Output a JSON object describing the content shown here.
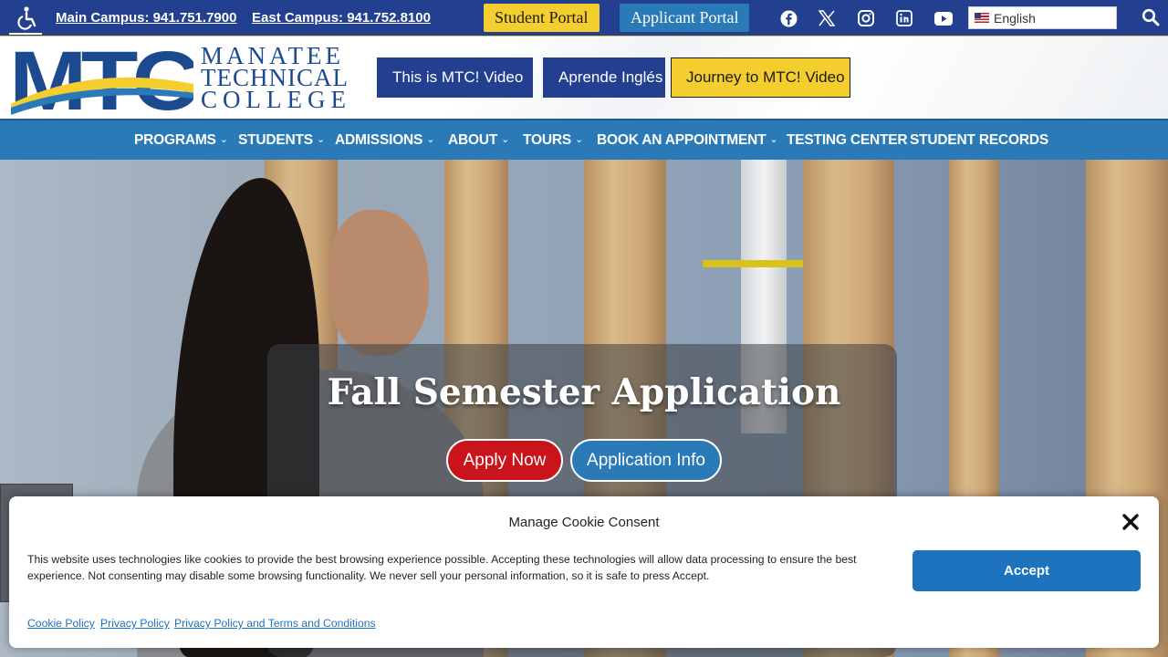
{
  "topbar": {
    "main_campus": "Main Campus: 941.751.7900",
    "east_campus": "East Campus: 941.752.8100",
    "student_portal": "Student Portal",
    "applicant_portal": "Applicant Portal",
    "social_icons": [
      "facebook-icon",
      "x-icon",
      "instagram-icon",
      "linkedin-icon",
      "youtube-icon"
    ],
    "language": "English"
  },
  "header": {
    "logo_abbrev": "MTC",
    "logo_line1": "MANATEE",
    "logo_line2": "TECHNICAL",
    "logo_line3": "COLLEGE",
    "buttons": [
      "This is MTC! Video",
      "Aprende Inglés",
      "Journey to MTC! Video"
    ]
  },
  "nav": {
    "items": [
      {
        "label": "PROGRAMS",
        "has_dropdown": true
      },
      {
        "label": "STUDENTS",
        "has_dropdown": true
      },
      {
        "label": "ADMISSIONS",
        "has_dropdown": true
      },
      {
        "label": "ABOUT",
        "has_dropdown": true
      },
      {
        "label": "TOURS",
        "has_dropdown": true
      },
      {
        "label": "BOOK AN APPOINTMENT",
        "has_dropdown": true
      },
      {
        "label": "TESTING CENTER",
        "has_dropdown": false
      },
      {
        "label": "STUDENT RECORDS",
        "has_dropdown": false
      }
    ]
  },
  "hero": {
    "title": "Fall Semester Application",
    "apply_label": "Apply Now",
    "info_label": "Application Info"
  },
  "cookie": {
    "title": "Manage Cookie Consent",
    "body": "This website uses technologies like cookies to provide the best browsing experience possible. Accepting these technologies will allow data processing to ensure the best experience. Not consenting may disable some browsing functionality. We never sell your personal information, so it is safe to press Accept.",
    "accept_label": "Accept",
    "links": [
      "Cookie Policy",
      "Privacy Policy",
      "Privacy Policy and Terms and Conditions"
    ]
  },
  "colors": {
    "navy": "#22408f",
    "blue": "#2a7ab8",
    "yellow": "#f4cd2e",
    "red": "#c9141b",
    "accept_blue": "#1e73be"
  }
}
